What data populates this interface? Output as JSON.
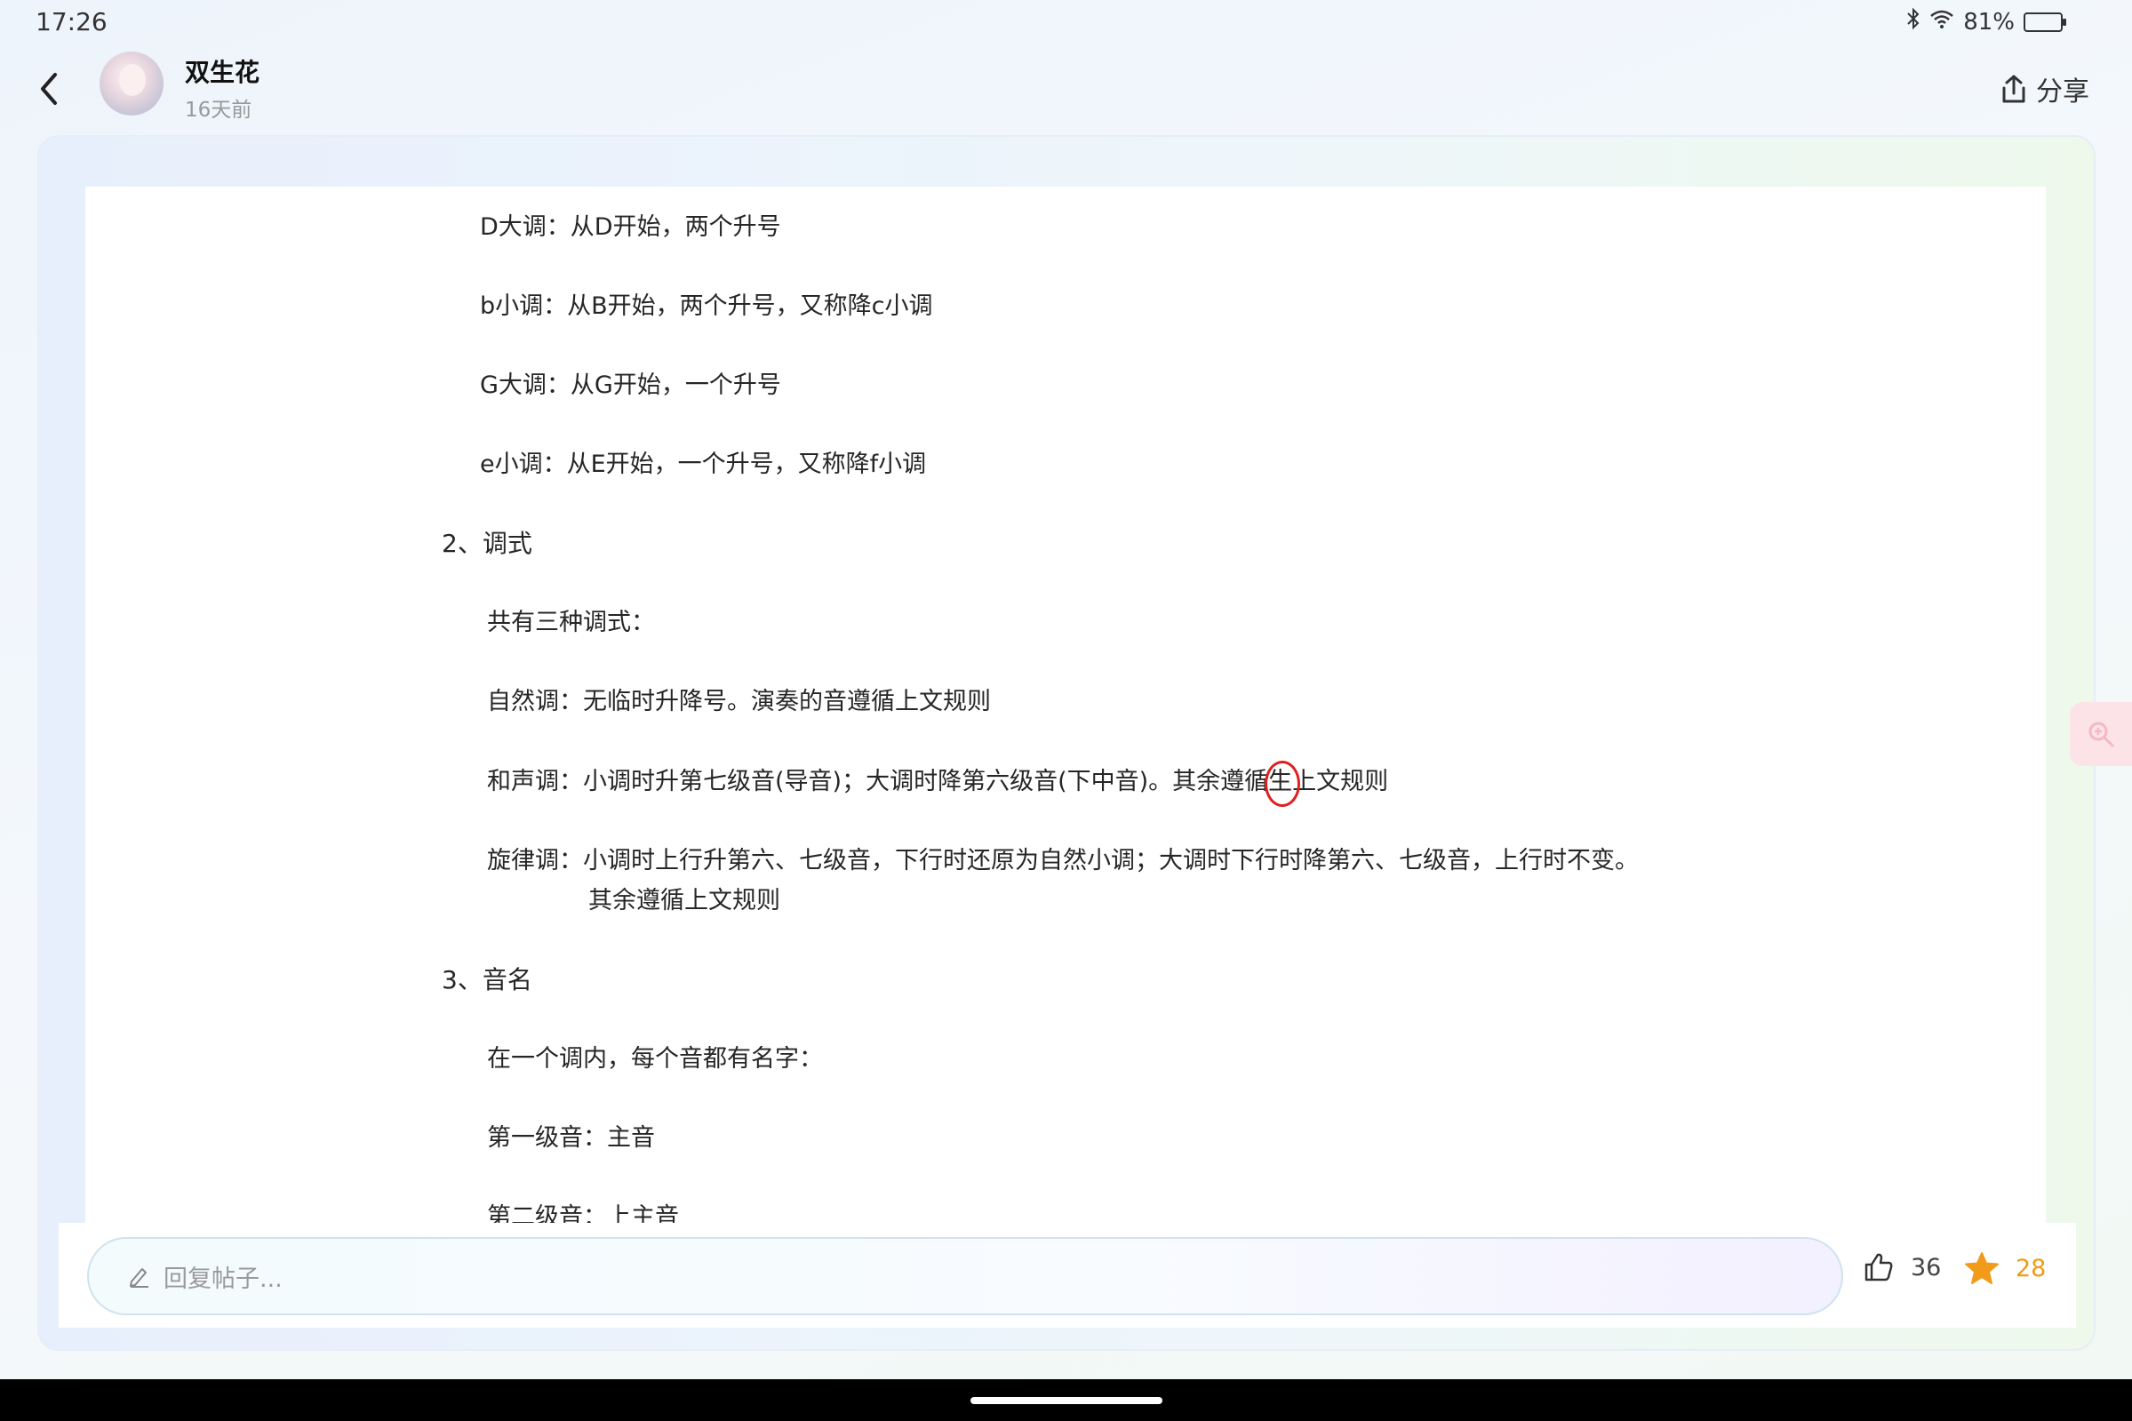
{
  "status": {
    "time": "17:26",
    "battery_text": "81%",
    "battery_level": 0.81,
    "bluetooth_icon": "bluetooth-icon",
    "wifi_icon": "wifi-icon"
  },
  "header": {
    "user_name": "双生花",
    "post_time": "16天前",
    "share_label": "分享"
  },
  "content": {
    "lines": [
      "D大调：从D开始，两个升号",
      "b小调：从B开始，两个升号，又称降c小调",
      "G大调：从G开始，一个升号",
      "e小调：从E开始，一个升号，又称降f小调",
      "2、调式",
      "共有三种调式：",
      "自然调：无临时升降号。演奏的音遵循上文规则",
      "和声调：小调时升第七级音(导音)；大调时降第六级音(下中音)。其余遵循",
      "生",
      "上文规则",
      "旋律调：小调时上行升第六、七级音，下行时还原为自然小调；大调时下行时降第六、七级音，上行时不变。",
      "其余遵循上文规则",
      "3、音名",
      "在一个调内，每个音都有名字：",
      "第一级音：主音",
      "第二级音：上主音"
    ]
  },
  "reply": {
    "placeholder": "回复帖子..."
  },
  "stats": {
    "likes": "36",
    "stars": "28"
  },
  "colors": {
    "star": "#f29a1a",
    "annotation": "#e02020",
    "battery": "#3ecf3a"
  }
}
